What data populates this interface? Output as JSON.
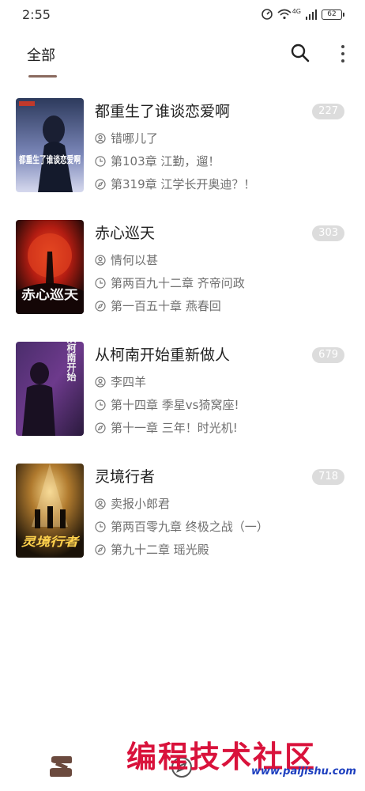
{
  "status_bar": {
    "time": "2:55",
    "network": "4G",
    "battery": "62"
  },
  "header": {
    "tab_label": "全部",
    "search_icon": "search-icon",
    "more_icon": "more-vertical-icon"
  },
  "books": [
    {
      "title": "都重生了谁谈恋爱啊",
      "author": "错哪儿了",
      "latest_chapter": "第103章 江勤，遛！",
      "read_chapter": "第319章 江学长开奥迪？！",
      "badge": "227",
      "cover_text": "都重生了谁谈恋爱啊"
    },
    {
      "title": "赤心巡天",
      "author": "情何以甚",
      "latest_chapter": "第两百九十二章 齐帝问政",
      "read_chapter": "第一百五十章 燕春回",
      "badge": "303",
      "cover_text": "赤心巡天"
    },
    {
      "title": "从柯南开始重新做人",
      "author": "李四羊",
      "latest_chapter": "第十四章 季星vs猗窝座!",
      "read_chapter": "第十一章 三年！时光机!",
      "badge": "679",
      "cover_text": "从柯南开始"
    },
    {
      "title": "灵境行者",
      "author": "卖报小郎君",
      "latest_chapter": "第两百零九章 终极之战（一）",
      "read_chapter": "第九十二章 瑶光殿",
      "badge": "718",
      "cover_text": "灵境行者"
    }
  ],
  "bottom_nav": {
    "shelf_icon": "bookshelf-icon",
    "discover_icon": "compass-icon"
  },
  "watermark": {
    "text": "编程技术社区",
    "url": "www.paijishu.com"
  },
  "colors": {
    "accent": "#8a6a5e",
    "badge_bg": "#dcdcdc",
    "meta_text": "#6f6f6f"
  }
}
